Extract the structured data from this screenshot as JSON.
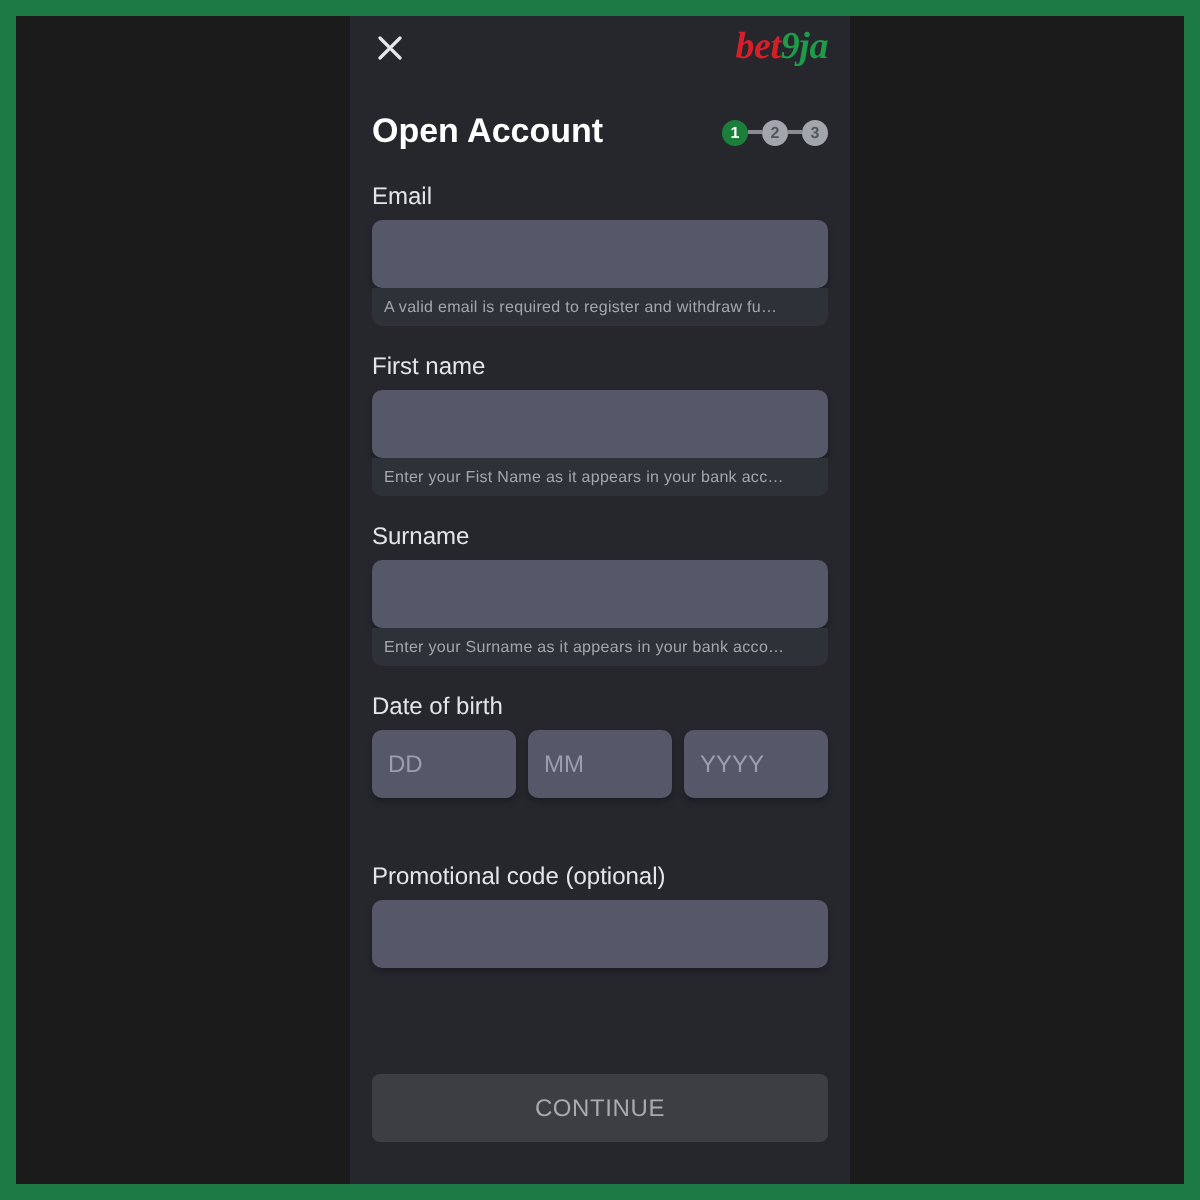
{
  "logo": {
    "parts": [
      {
        "text": "bet",
        "color": "#d5202a"
      },
      {
        "text": "9ja",
        "color": "#1f9a48"
      }
    ]
  },
  "title": "Open Account",
  "steps": [
    {
      "label": "1",
      "selected": true
    },
    {
      "label": "2",
      "selected": false
    },
    {
      "label": "3",
      "selected": false
    }
  ],
  "fields": [
    {
      "kind": "text",
      "label": "Email",
      "hint": "A valid email is required to register and withdraw fu…"
    },
    {
      "kind": "text",
      "label": "First name",
      "hint": "Enter your Fist Name as it appears in your bank acc…"
    },
    {
      "kind": "text",
      "label": "Surname",
      "hint": "Enter your Surname as it appears in your bank acco…"
    },
    {
      "kind": "date",
      "label": "Date of birth",
      "parts": [
        {
          "placeholder": "DD"
        },
        {
          "placeholder": "MM"
        },
        {
          "placeholder": "YYYY"
        }
      ]
    },
    {
      "kind": "text",
      "label": "Promotional code (optional)"
    }
  ],
  "continue_button": {
    "label": "CONTINUE",
    "disabled": true
  }
}
